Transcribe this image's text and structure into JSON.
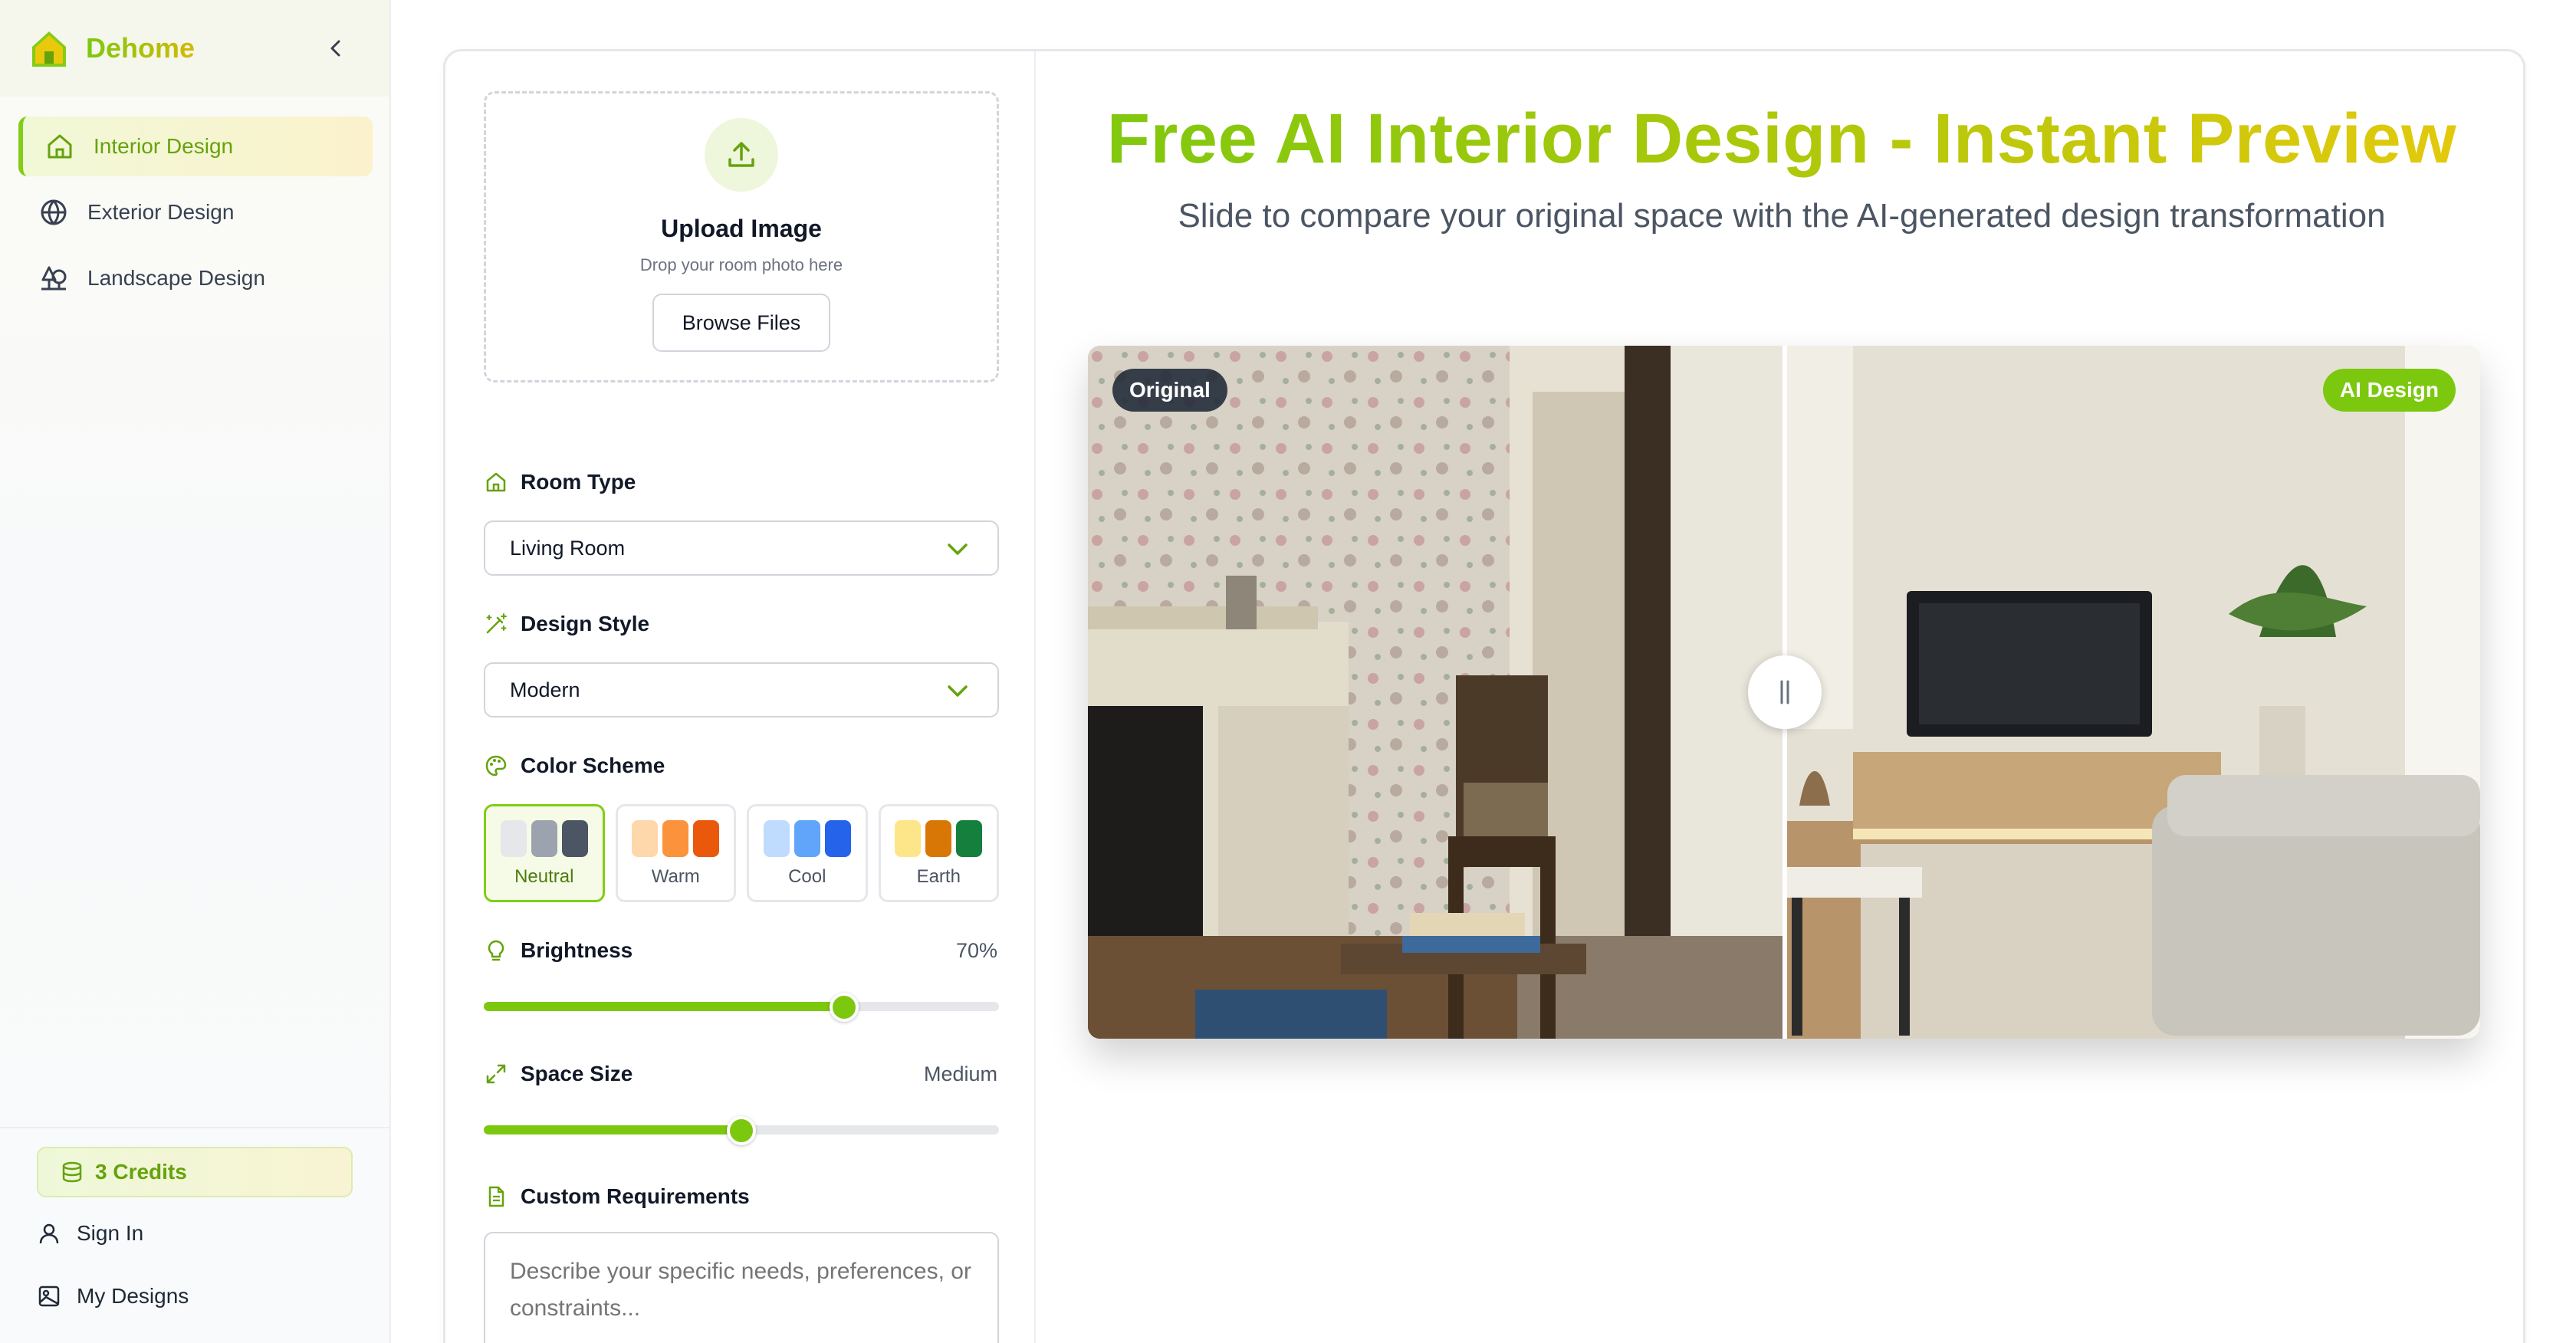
{
  "brand": {
    "name": "Dehome"
  },
  "nav": [
    {
      "label": "Interior Design",
      "icon": "home-icon",
      "active": true
    },
    {
      "label": "Exterior Design",
      "icon": "globe-icon",
      "active": false
    },
    {
      "label": "Landscape Design",
      "icon": "trees-icon",
      "active": false
    }
  ],
  "footer": {
    "credits": "3 Credits",
    "sign_in": "Sign In",
    "my_designs": "My Designs"
  },
  "upload": {
    "title": "Upload Image",
    "subtitle": "Drop your room photo here",
    "button": "Browse Files"
  },
  "room_type": {
    "label": "Room Type",
    "value": "Living Room"
  },
  "design_style": {
    "label": "Design Style",
    "value": "Modern"
  },
  "color_scheme": {
    "label": "Color Scheme",
    "options": [
      {
        "name": "Neutral",
        "colors": [
          "#e5e7eb",
          "#9ca3af",
          "#4b5563"
        ],
        "selected": true
      },
      {
        "name": "Warm",
        "colors": [
          "#fed7aa",
          "#fb923c",
          "#ea580c"
        ],
        "selected": false
      },
      {
        "name": "Cool",
        "colors": [
          "#bfdbfe",
          "#60a5fa",
          "#2563eb"
        ],
        "selected": false
      },
      {
        "name": "Earth",
        "colors": [
          "#fde68a",
          "#d97706",
          "#15803d"
        ],
        "selected": false
      }
    ]
  },
  "brightness": {
    "label": "Brightness",
    "value": "70%",
    "level": 0.7
  },
  "space_size": {
    "label": "Space Size",
    "value": "Medium",
    "level": 0.5
  },
  "custom": {
    "label": "Custom Requirements",
    "placeholder": "Describe your specific needs, preferences, or constraints..."
  },
  "preview": {
    "title": "Free AI Interior Design - Instant Preview",
    "subtitle": "Slide to compare your original space with the AI-generated design transformation",
    "original_tag": "Original",
    "ai_tag": "AI Design",
    "compare_position": 0.5
  },
  "colors": {
    "accent": "#7cc80f",
    "accent_dark": "#65a30d",
    "gold": "#e8c90c"
  }
}
